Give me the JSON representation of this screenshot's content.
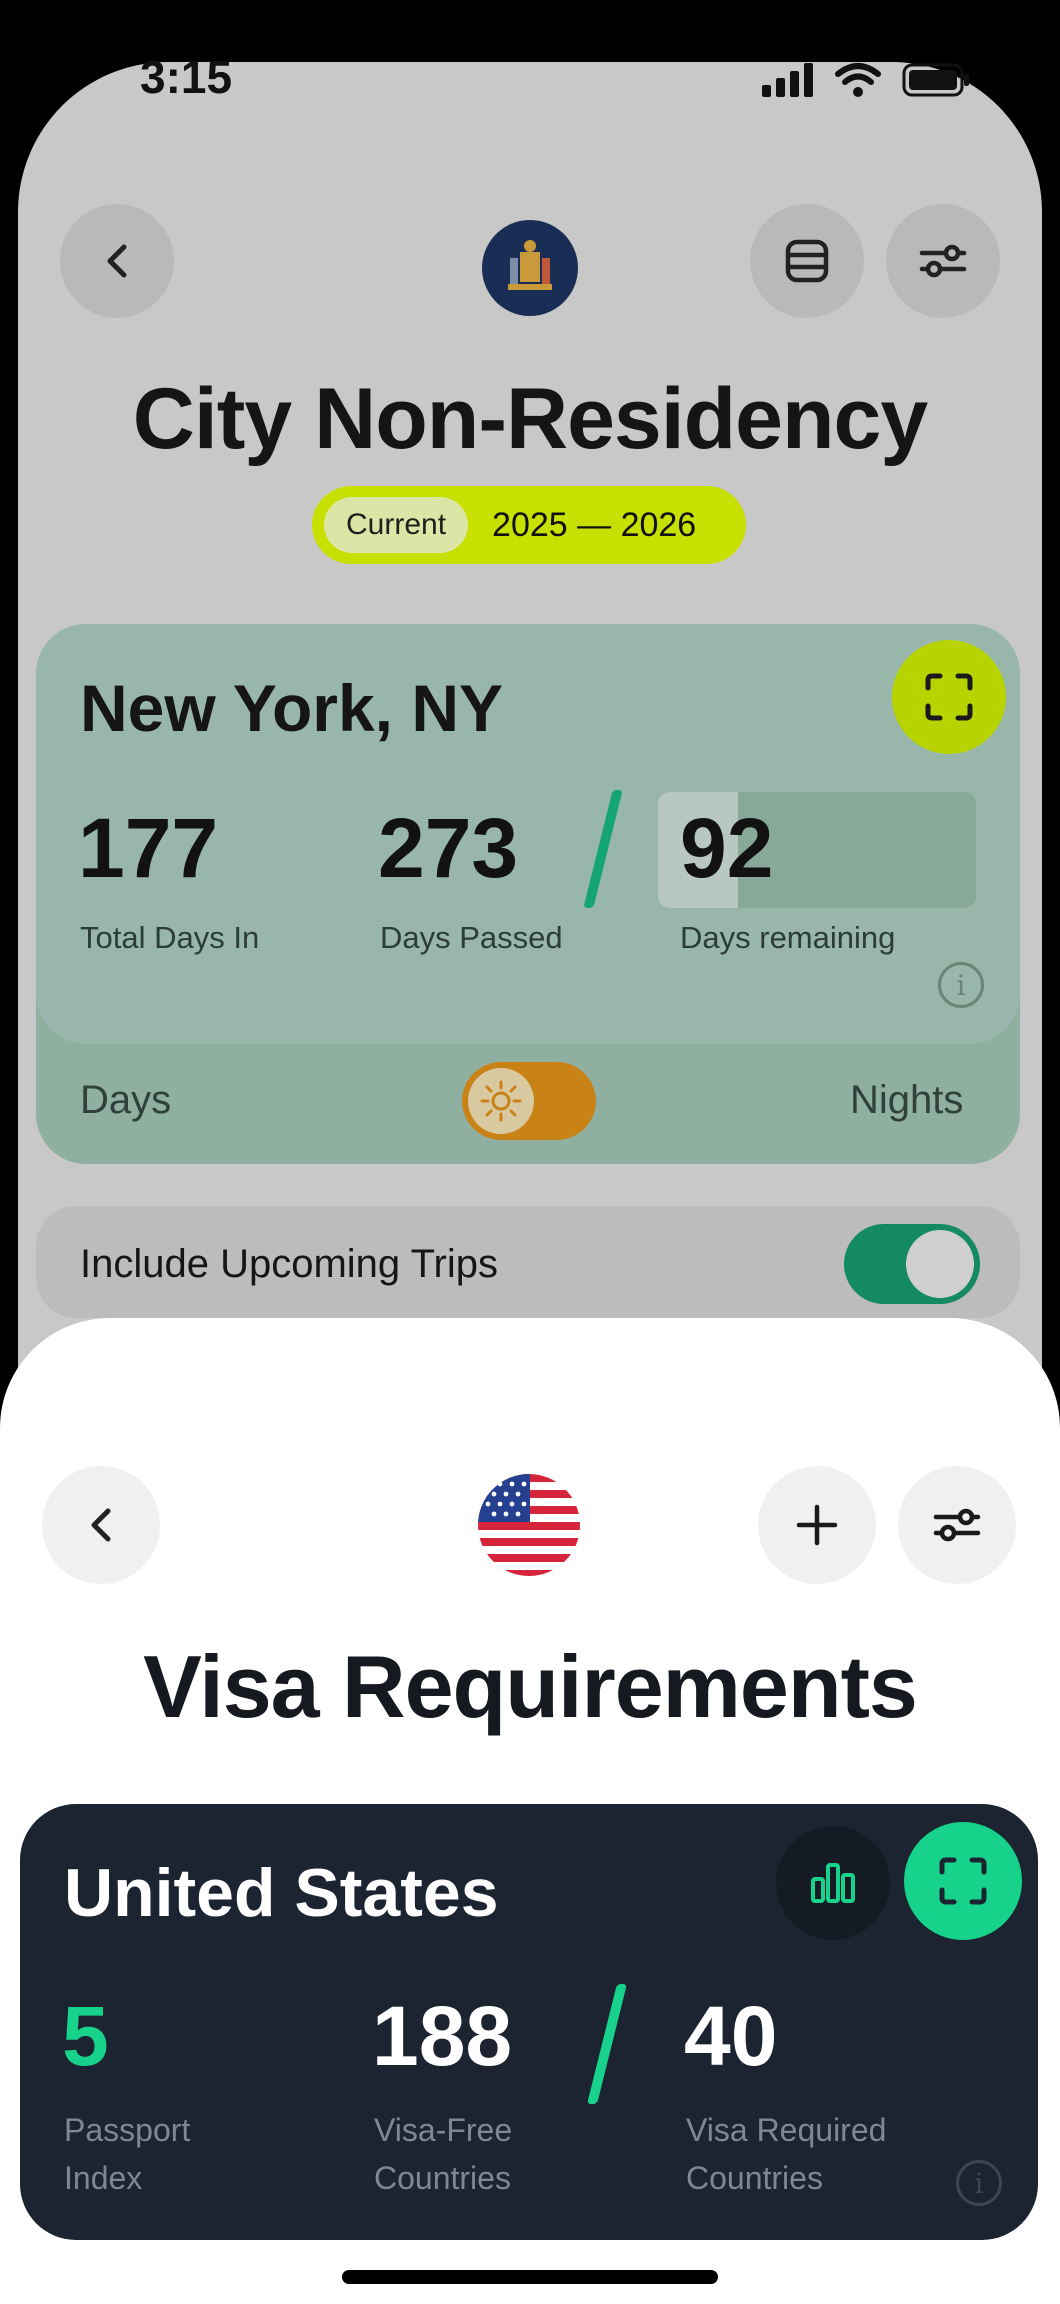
{
  "status_bar": {
    "time": "3:15"
  },
  "back_screen": {
    "title": "City Non-Residency",
    "period": {
      "badge": "Current",
      "range": "2025 — 2026"
    },
    "card": {
      "city": "New York, NY",
      "stats": [
        {
          "value": "177",
          "label": "Total Days In"
        },
        {
          "value": "273",
          "label": "Days Passed"
        },
        {
          "value": "92",
          "label": "Days remaining"
        }
      ],
      "remaining_fraction": 0.25,
      "toggle_left_label": "Days",
      "toggle_right_label": "Nights"
    },
    "upcoming_trips": {
      "label": "Include Upcoming Trips",
      "enabled": true
    }
  },
  "front_sheet": {
    "title": "Visa Requirements",
    "card": {
      "country": "United States",
      "stats": [
        {
          "value": "5",
          "label_line1": "Passport",
          "label_line2": "Index"
        },
        {
          "value": "188",
          "label_line1": "Visa-Free",
          "label_line2": "Countries"
        },
        {
          "value": "40",
          "label_line1": "Visa Required",
          "label_line2": "Countries"
        }
      ]
    }
  },
  "colors": {
    "accent_lime": "#c8e000",
    "accent_green": "#16d28a",
    "card_dark": "#1c2431"
  },
  "icons": [
    "back-chevron-icon",
    "list-icon",
    "sliders-icon",
    "crest-icon",
    "fullscreen-icon",
    "sun-icon",
    "info-icon",
    "us-flag-icon",
    "plus-icon",
    "bar-chart-icon"
  ]
}
